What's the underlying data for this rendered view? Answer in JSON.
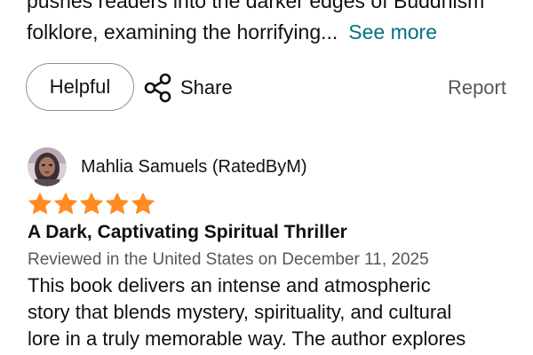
{
  "previous_review": {
    "lines": [
      "pushes readers into the darker edges of Buddhism",
      "folklore, examining the horrifying..."
    ],
    "see_more_label": "See more"
  },
  "actions": {
    "helpful_label": "Helpful",
    "share_label": "Share",
    "share_icon": "share-icon",
    "report_label": "Report"
  },
  "review": {
    "reviewer_name": "Mahlia Samuels (RatedByM)",
    "rating_stars": 5,
    "rating_max": 5,
    "star_color": "#ff8c23",
    "title": "A Dark, Captivating Spiritual Thriller",
    "date_line": "Reviewed in the United States on December 11, 2025",
    "body_lines": [
      "This book delivers an intense and atmospheric",
      "story that blends mystery, spirituality, and cultural",
      "lore in a truly memorable way. The author explores"
    ]
  },
  "colors": {
    "link": "#007185",
    "muted_text": "#565959",
    "primary_text": "#0f1111",
    "button_border": "#8d9096"
  }
}
